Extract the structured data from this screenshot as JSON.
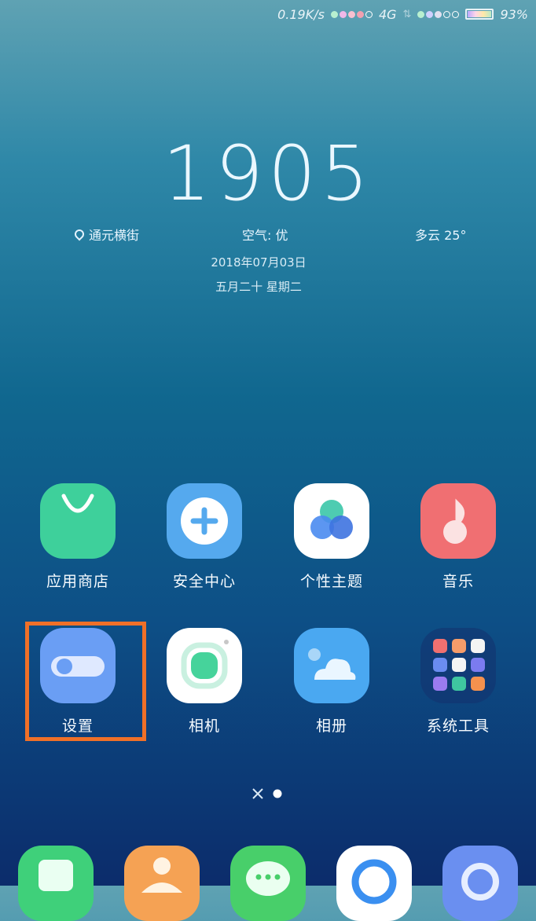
{
  "status_bar": {
    "speed": "0.19K/s",
    "network": "4G",
    "battery": "93%",
    "signal1_colors": [
      "#b8f0d0",
      "#f0b8e8",
      "#f8c0d0",
      "#f0a0b0",
      "#ffffff"
    ],
    "signal2_colors": [
      "#b8f0d0",
      "#d0d0ff",
      "#e0e0f0",
      "#ffffff",
      "#ffffff"
    ]
  },
  "clock": {
    "time": "1905"
  },
  "info": {
    "location": "通元横街",
    "air": "空气: 优",
    "weather": "多云 25°",
    "date": "2018年07月03日",
    "lunar": "五月二十  星期二"
  },
  "apps_row1": [
    {
      "label": "应用商店",
      "icon": "app-store-icon"
    },
    {
      "label": "安全中心",
      "icon": "security-center-icon"
    },
    {
      "label": "个性主题",
      "icon": "themes-icon"
    },
    {
      "label": "音乐",
      "icon": "music-icon"
    }
  ],
  "apps_row2": [
    {
      "label": "设置",
      "icon": "settings-icon"
    },
    {
      "label": "相机",
      "icon": "camera-icon"
    },
    {
      "label": "相册",
      "icon": "gallery-icon"
    },
    {
      "label": "系统工具",
      "icon": "system-tools-folder-icon"
    }
  ],
  "highlight_color": "#f07028"
}
